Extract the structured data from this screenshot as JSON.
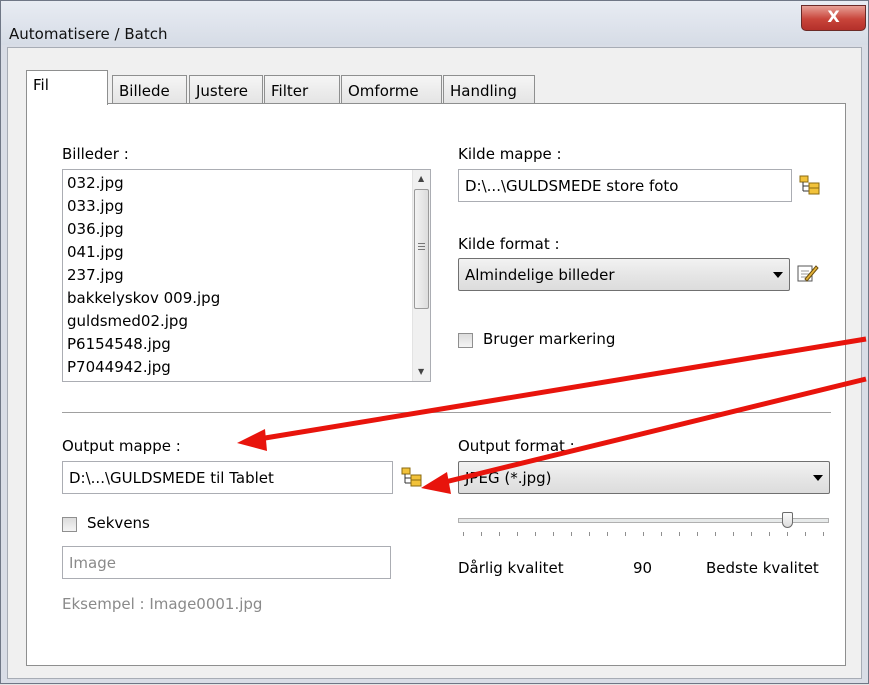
{
  "window": {
    "title": "Automatisere / Batch",
    "close_label": "X"
  },
  "tabs": [
    {
      "label": "Fil",
      "active": true
    },
    {
      "label": "Billede"
    },
    {
      "label": "Justere"
    },
    {
      "label": "Filter"
    },
    {
      "label": "Omforme"
    },
    {
      "label": "Handling"
    }
  ],
  "images": {
    "label": "Billeder :",
    "items": [
      "032.jpg",
      "033.jpg",
      "036.jpg",
      "041.jpg",
      "237.jpg",
      "bakkelyskov 009.jpg",
      "guldsmed02.jpg",
      "P6154548.jpg",
      "P7044942.jpg"
    ]
  },
  "source_folder": {
    "label": "Kilde mappe :",
    "value": "D:\\...\\GULDSMEDE store foto",
    "icon": "folder-tree-icon"
  },
  "source_format": {
    "label": "Kilde format :",
    "value": "Almindelige billeder",
    "icon": "edit-icon"
  },
  "use_selection": {
    "label": "Bruger markering",
    "checked": false
  },
  "output_folder": {
    "label": "Output mappe :",
    "value": "D:\\...\\GULDSMEDE til Tablet",
    "icon": "folder-tree-icon"
  },
  "output_format": {
    "label": "Output format :",
    "value": "JPEG (*.jpg)"
  },
  "sequence": {
    "label": "Sekvens",
    "checked": false,
    "placeholder": "Image",
    "example": "Eksempel : Image0001.jpg"
  },
  "quality": {
    "min_label": "Dårlig kvalitet",
    "value": 90,
    "max_label": "Bedste kvalitet",
    "min": 0,
    "max": 100
  },
  "colors": {
    "annotation_arrow": "#e8140c",
    "close_button": "#c8443a"
  }
}
